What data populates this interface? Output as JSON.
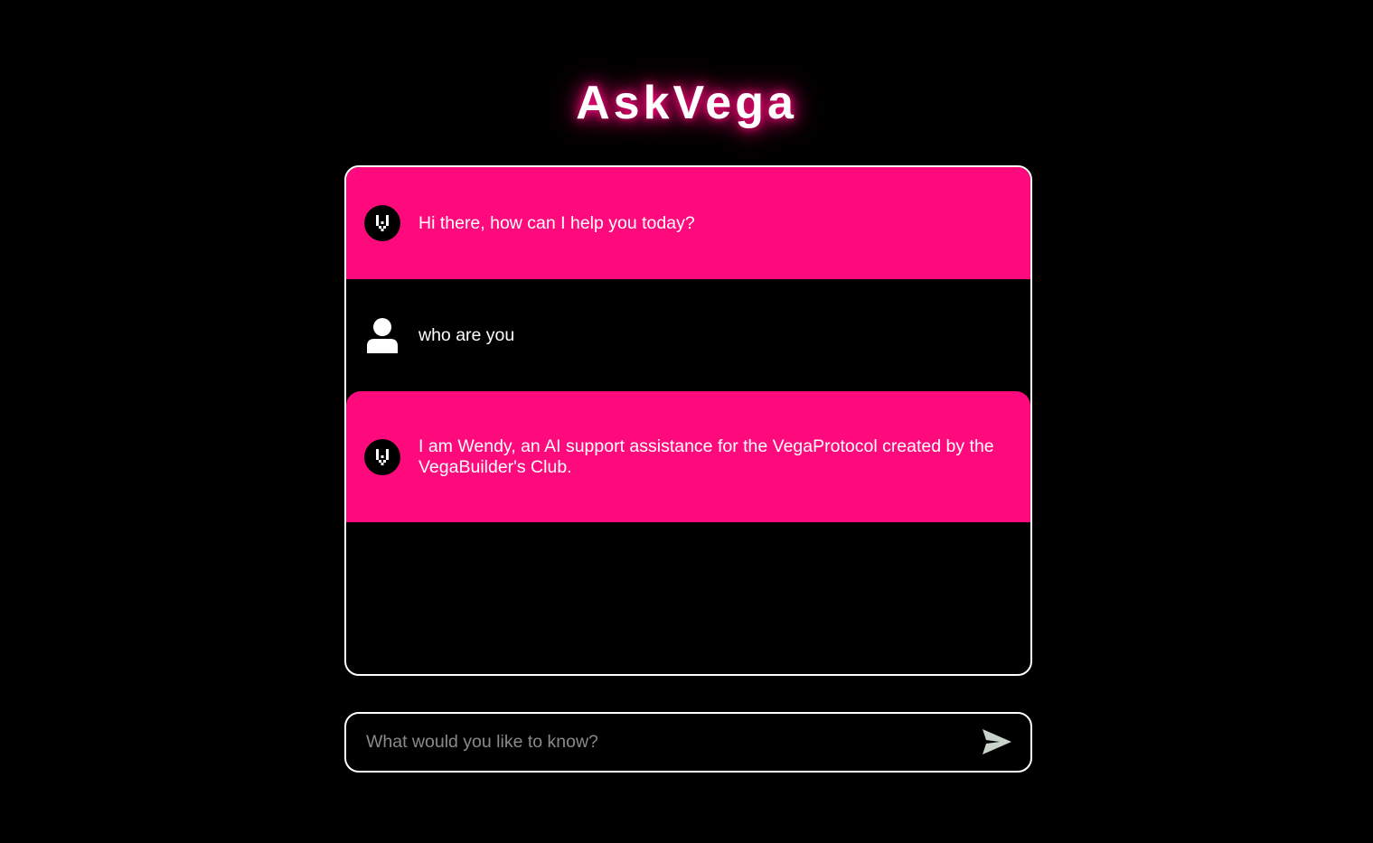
{
  "app": {
    "title": "AskVega",
    "accent_color": "#ff0a7c"
  },
  "chat": {
    "messages": [
      {
        "role": "bot",
        "avatar_icon": "vega-logo-icon",
        "text": "Hi there, how can I help you today?"
      },
      {
        "role": "user",
        "avatar_icon": "user-icon",
        "text": "who are you"
      },
      {
        "role": "bot",
        "avatar_icon": "vega-logo-icon",
        "text": "I am Wendy, an AI support assistance for the VegaProtocol created by the VegaBuilder's Club."
      }
    ]
  },
  "input": {
    "value": "",
    "placeholder": "What would you like to know?",
    "send_icon": "send-icon"
  }
}
